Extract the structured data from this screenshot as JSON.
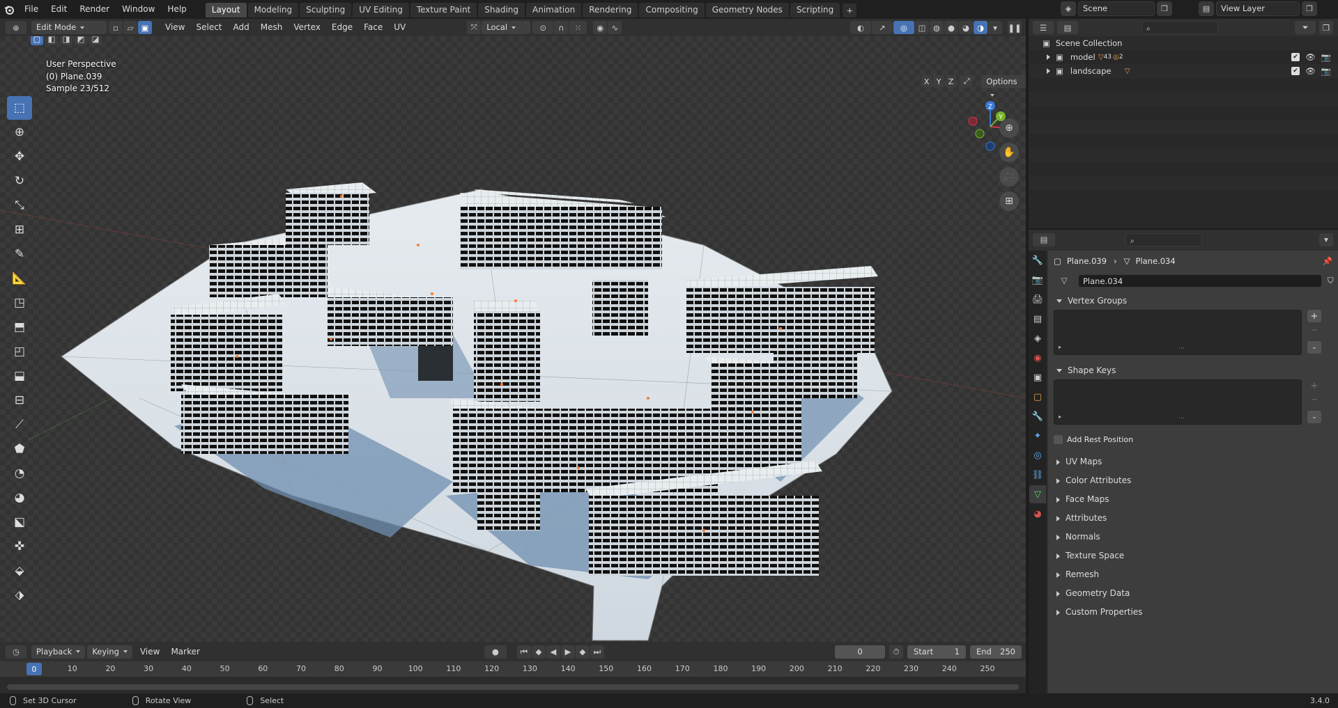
{
  "menu": [
    "File",
    "Edit",
    "Render",
    "Window",
    "Help"
  ],
  "workspaces": [
    {
      "label": "Layout",
      "active": true
    },
    {
      "label": "Modeling"
    },
    {
      "label": "Sculpting"
    },
    {
      "label": "UV Editing"
    },
    {
      "label": "Texture Paint"
    },
    {
      "label": "Shading"
    },
    {
      "label": "Animation"
    },
    {
      "label": "Rendering"
    },
    {
      "label": "Compositing"
    },
    {
      "label": "Geometry Nodes"
    },
    {
      "label": "Scripting"
    }
  ],
  "scene": {
    "name": "Scene",
    "view_layer": "View Layer"
  },
  "viewport_header": {
    "mode": "Edit Mode",
    "menus": [
      "View",
      "Select",
      "Add",
      "Mesh",
      "Vertex",
      "Edge",
      "Face",
      "UV"
    ],
    "transform_orientation": "Local",
    "options": "Options"
  },
  "viewport": {
    "perspective": "User Perspective",
    "object_info": "(0) Plane.039",
    "samples": "Sample 23/512",
    "axis_buttons": [
      "X",
      "Y",
      "Z"
    ]
  },
  "tools": [
    "select",
    "cursor",
    "move",
    "rotate",
    "scale",
    "transform",
    "annotate",
    "measure",
    "add-cube",
    "extrude",
    "inset",
    "bevel",
    "loop-cut",
    "knife",
    "poly-build",
    "spin",
    "smooth",
    "edge-slide",
    "shrink",
    "shear",
    "rip"
  ],
  "timeline": {
    "menus": [
      "Playback",
      "Keying",
      "View",
      "Marker"
    ],
    "current_frame": "0",
    "start_label": "Start",
    "start": "1",
    "end_label": "End",
    "end": "250",
    "ticks": [
      "0",
      "10",
      "20",
      "30",
      "40",
      "50",
      "60",
      "70",
      "80",
      "90",
      "100",
      "110",
      "120",
      "130",
      "140",
      "150",
      "160",
      "170",
      "180",
      "190",
      "200",
      "210",
      "220",
      "230",
      "240",
      "250"
    ]
  },
  "statusbar": {
    "left": "Set 3D Cursor",
    "middle": "Rotate View",
    "right": "Select",
    "version": "3.4.0"
  },
  "outliner": {
    "root": "Scene Collection",
    "items": [
      {
        "name": "model",
        "badge": "43",
        "badge2": "2"
      },
      {
        "name": "landscape"
      }
    ]
  },
  "properties": {
    "breadcrumb_object": "Plane.039",
    "breadcrumb_mesh": "Plane.034",
    "mesh_name": "Plane.034",
    "vertex_groups": "Vertex Groups",
    "shape_keys": "Shape Keys",
    "add_rest_position": "Add Rest Position",
    "collapsed_panels": [
      "UV Maps",
      "Color Attributes",
      "Face Maps",
      "Attributes",
      "Normals",
      "Texture Space",
      "Remesh",
      "Geometry Data",
      "Custom Properties"
    ]
  },
  "colors": {
    "accent": "#4772b3",
    "header": "#303030",
    "panel": "#3d3d3d"
  }
}
